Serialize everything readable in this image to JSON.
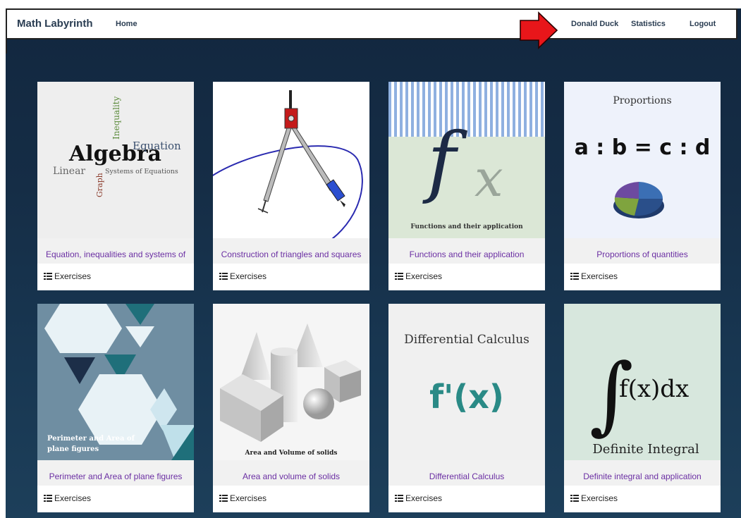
{
  "navbar": {
    "brand": "Math Labyrinth",
    "home": "Home",
    "user": "Donald Duck",
    "statistics": "Statistics",
    "logout": "Logout"
  },
  "colors": {
    "title_text": "#6b2fa3",
    "arrow": "#e8161a",
    "background": "#152d46"
  },
  "cards": [
    {
      "title": "Equation, inequalities and systems of equations",
      "exercises": "Exercises",
      "image_text": [
        "Algebra",
        "Equation",
        "Inequality",
        "Linear",
        "Systems of Equations",
        "Graph"
      ]
    },
    {
      "title": "Construction of triangles and squares",
      "exercises": "Exercises"
    },
    {
      "title": "Functions and their application",
      "exercises": "Exercises",
      "image_text": [
        "f",
        "x",
        "Functions and their application"
      ]
    },
    {
      "title": "Proportions of quantities",
      "exercises": "Exercises",
      "image_text": [
        "Proportions",
        "a : b = c : d"
      ]
    },
    {
      "title": "Perimeter and Area of plane figures",
      "exercises": "Exercises",
      "image_text": [
        "Perimeter and Area of",
        "plane figures"
      ]
    },
    {
      "title": "Area and volume of solids",
      "exercises": "Exercises",
      "image_text": [
        "Area and Volume of solids"
      ]
    },
    {
      "title": "Differential Calculus",
      "exercises": "Exercises",
      "image_text": [
        "Differential Calculus",
        "f'(x)"
      ]
    },
    {
      "title": "Definite integral and application",
      "exercises": "Exercises",
      "image_text": [
        "∫",
        "f(x)dx",
        "Definite Integral"
      ]
    }
  ]
}
